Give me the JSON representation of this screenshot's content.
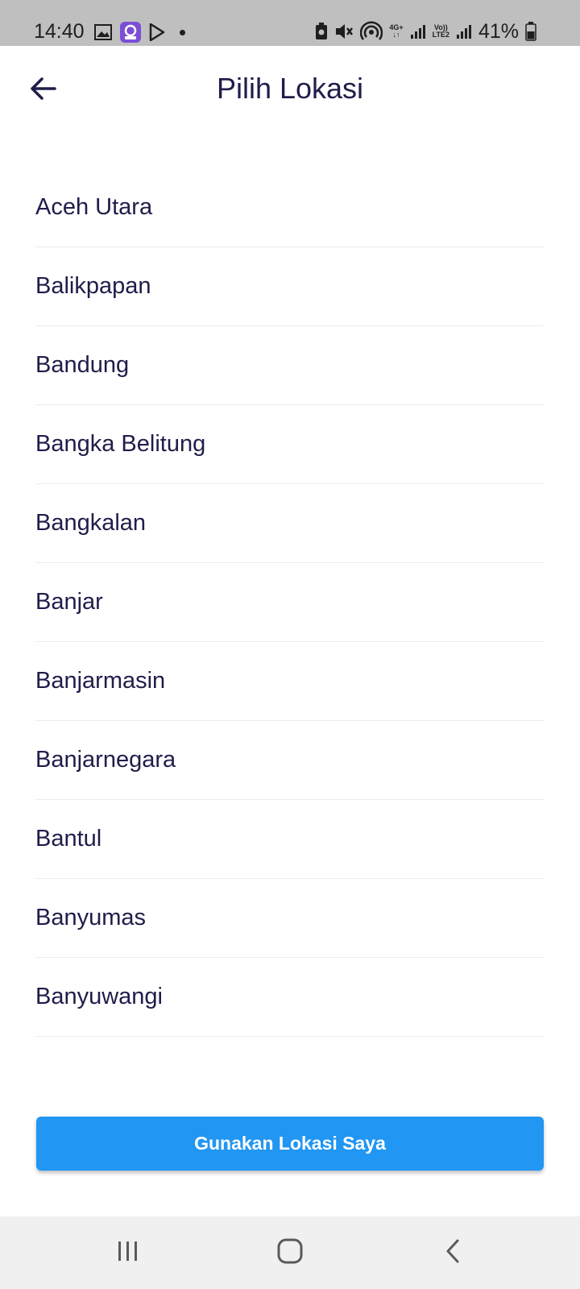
{
  "status_bar": {
    "time": "14:40",
    "network": "4G+",
    "volte": "Vo))",
    "lte": "LTE2",
    "battery": "41%"
  },
  "header": {
    "title": "Pilih Lokasi",
    "back_icon": "arrow-left-icon"
  },
  "locations": [
    "Aceh Utara",
    "Balikpapan",
    "Bandung",
    "Bangka Belitung",
    "Bangkalan",
    "Banjar",
    "Banjarmasin",
    "Banjarnegara",
    "Bantul",
    "Banyumas",
    "Banyuwangi"
  ],
  "primary_button": {
    "label": "Gunakan Lokasi Saya",
    "color": "#2196f3"
  },
  "nav_bar": {
    "icons": [
      "recents-icon",
      "home-icon",
      "back-icon"
    ]
  },
  "colors": {
    "text": "#1f1d4a",
    "divider": "#ebebef",
    "status_bar": "#bfbfbf",
    "nav_bar": "#f0f0f0"
  }
}
